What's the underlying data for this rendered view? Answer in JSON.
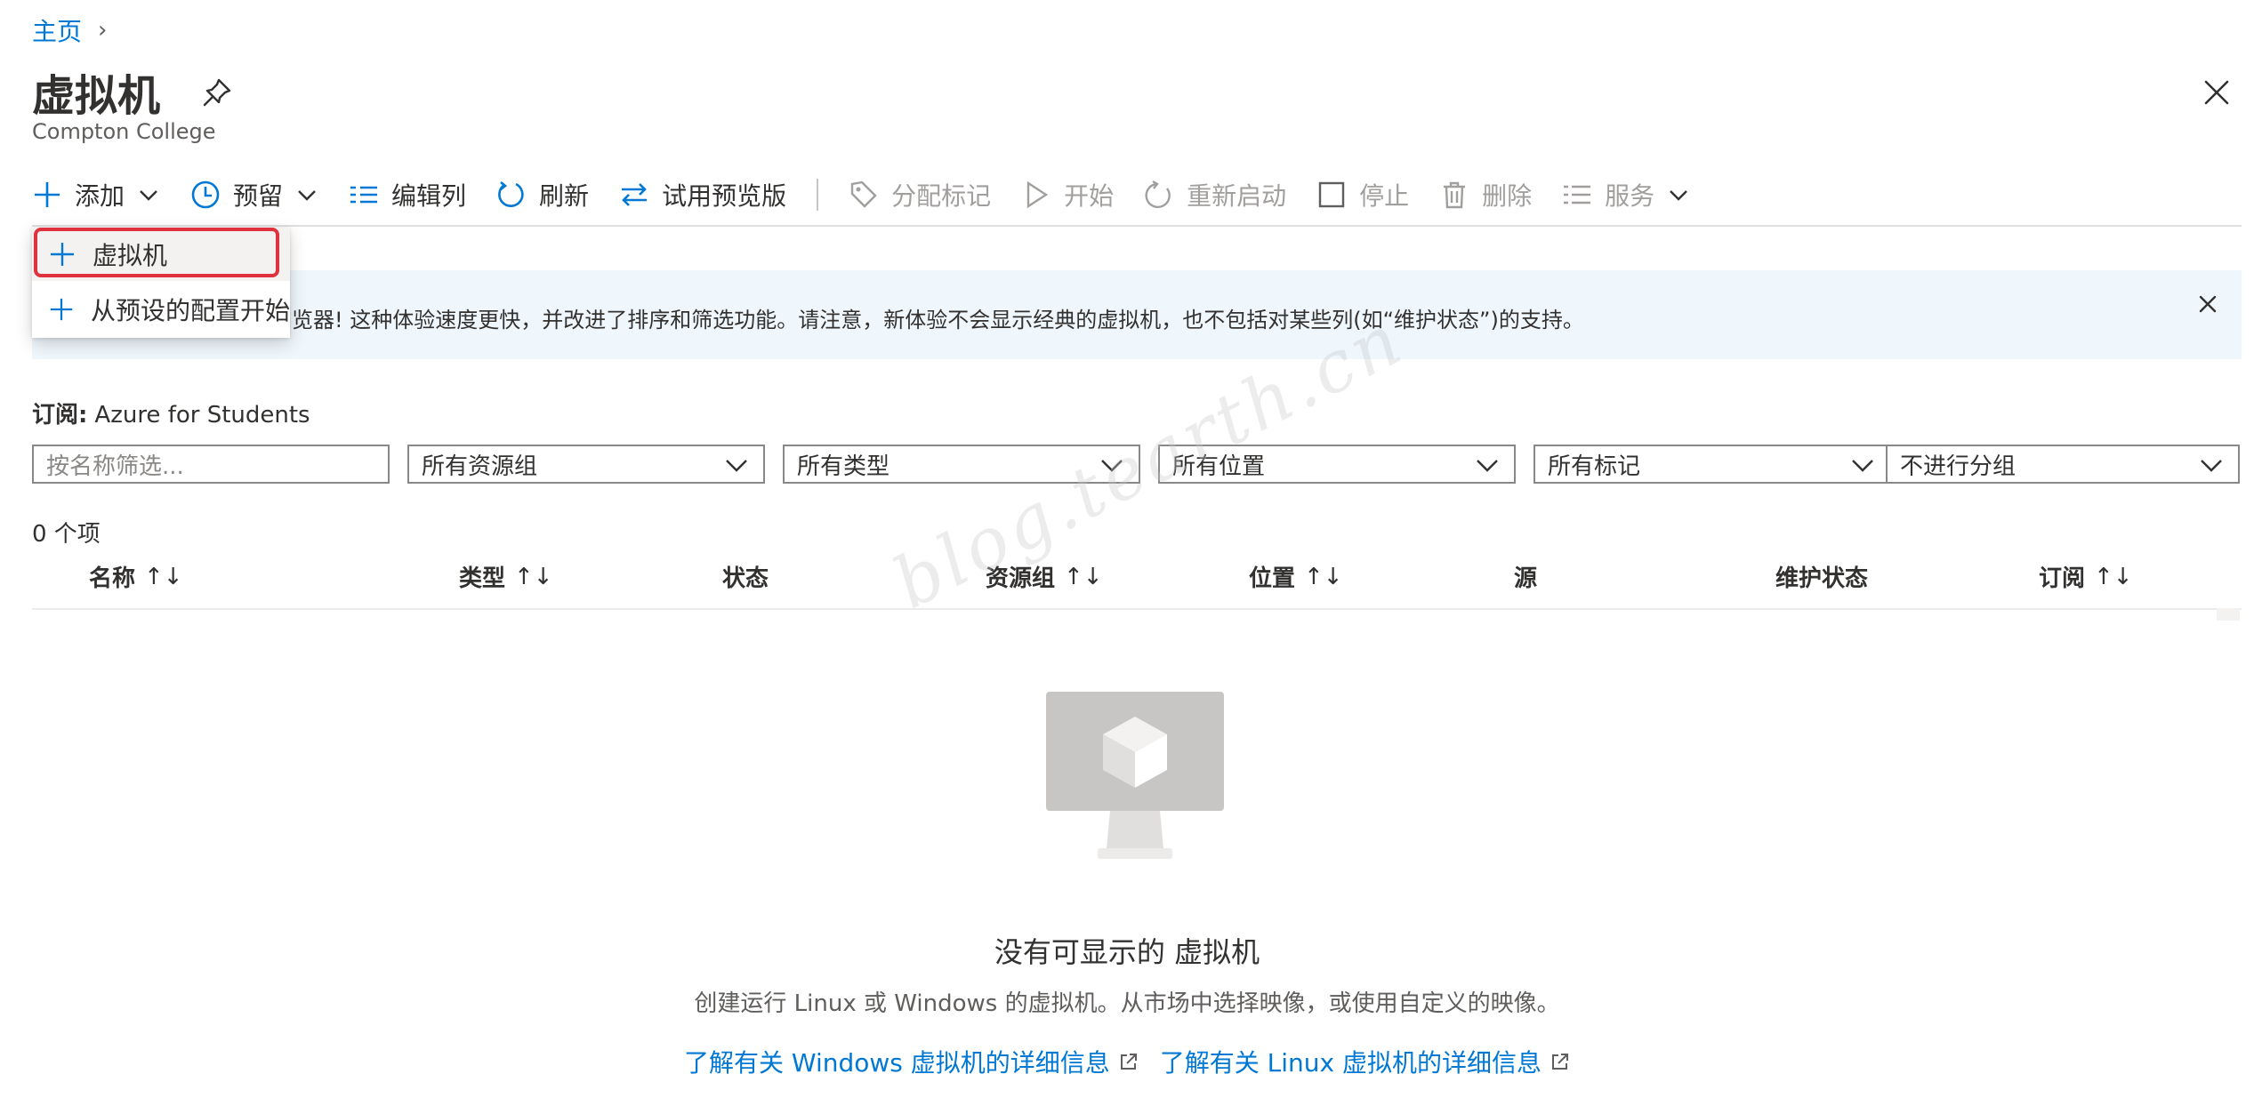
{
  "breadcrumb": {
    "home": "主页",
    "separator": "›"
  },
  "header": {
    "title": "虚拟机",
    "subtitle": "Compton College"
  },
  "toolbar": {
    "add": "添加",
    "reservations": "预留",
    "edit_columns": "编辑列",
    "refresh": "刷新",
    "try_preview": "试用预览版",
    "assign_tags": "分配标记",
    "start": "开始",
    "restart": "重新启动",
    "stop": "停止",
    "delete": "删除",
    "services": "服务"
  },
  "add_menu": {
    "items": [
      "虚拟机",
      "从预设的配置开始"
    ]
  },
  "info_banner": {
    "text": "原浏览器! 这种体验速度更快，并改进了排序和筛选功能。请注意，新体验不会显示经典的虚拟机，也不包括对某些列(如“维护状态”)的支持。"
  },
  "subscription": {
    "label": "订阅:",
    "value": "Azure for Students"
  },
  "filters": {
    "name_placeholder": "按名称筛选...",
    "resource_group": "所有资源组",
    "type": "所有类型",
    "location": "所有位置",
    "tags": "所有标记",
    "grouping": "不进行分组"
  },
  "table": {
    "count": "0 个项",
    "columns": [
      "名称",
      "类型",
      "状态",
      "资源组",
      "位置",
      "源",
      "维护状态",
      "订阅"
    ],
    "sort_glyph": "↑↓"
  },
  "empty_state": {
    "title": "没有可显示的 虚拟机",
    "description": "创建运行 Linux 或 Windows 的虚拟机。从市场中选择映像，或使用自定义的映像。",
    "link_windows": "了解有关 Windows 虚拟机的详细信息",
    "link_linux": "了解有关 Linux 虚拟机的详细信息"
  },
  "watermark": "blog.tearth.cn",
  "colors": {
    "accent": "#0078d4",
    "highlight": "#e0313f",
    "info_bg": "#eff6fc",
    "disabled": "#a19f9d"
  }
}
